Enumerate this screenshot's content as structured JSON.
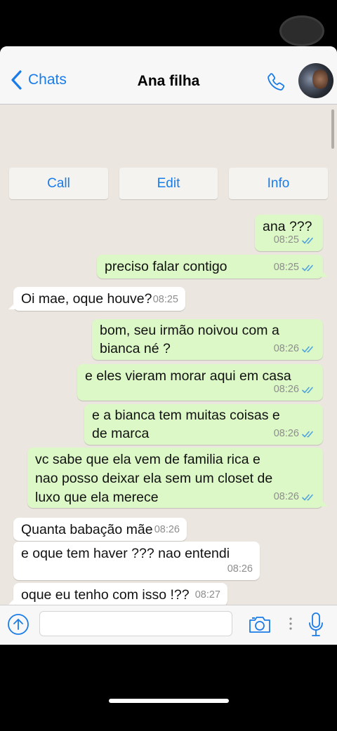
{
  "header": {
    "back_label": "Chats",
    "title": "Ana filha",
    "back_icon": "chevron-left-icon",
    "call_icon": "phone-icon"
  },
  "actions": [
    {
      "label": "Call"
    },
    {
      "label": "Edit"
    },
    {
      "label": "Info"
    }
  ],
  "messages": [
    {
      "direction": "out",
      "text": "ana ???",
      "time": "08:25",
      "status": "read"
    },
    {
      "direction": "out",
      "text": "preciso falar contigo",
      "time": "08:25",
      "status": "read"
    },
    {
      "direction": "in",
      "text": "Oi mae, oque houve?",
      "time": "08:25"
    },
    {
      "direction": "out",
      "text": "bom, seu irmão noivou com a bianca né ?",
      "time": "08:26",
      "status": "read"
    },
    {
      "direction": "out",
      "text": "e eles vieram morar aqui em casa",
      "time": "08:26",
      "status": "read"
    },
    {
      "direction": "out",
      "text": "e a bianca tem muitas coisas e de marca",
      "time": "08:26",
      "status": "read"
    },
    {
      "direction": "out",
      "text": "vc sabe que ela vem de familia rica e nao posso deixar ela sem um closet de luxo que ela merece",
      "time": "08:26",
      "status": "read"
    },
    {
      "direction": "in",
      "text": "Quanta babação mãe",
      "time": "08:26"
    },
    {
      "direction": "in",
      "text": "e oque tem haver ??? nao entendi",
      "time": "08:26"
    },
    {
      "direction": "in",
      "text": "oque eu tenho com isso !??",
      "time": "08:27"
    }
  ],
  "input": {
    "placeholder": "",
    "value": ""
  },
  "colors": {
    "accent": "#1a7ce8",
    "outgoing_bubble": "#dcf8c6",
    "incoming_bubble": "#ffffff",
    "chat_background": "#ebe6df",
    "read_ticks": "#4fa3e0"
  }
}
